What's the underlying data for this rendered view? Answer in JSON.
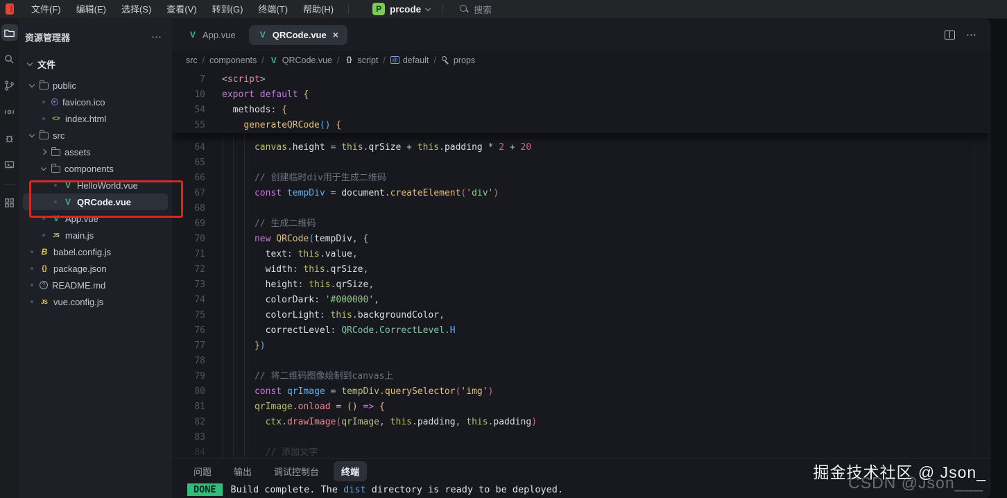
{
  "title_bar": {
    "menus": [
      {
        "id": "file",
        "label": "文件(F)"
      },
      {
        "id": "edit",
        "label": "编辑(E)"
      },
      {
        "id": "selection",
        "label": "选择(S)"
      },
      {
        "id": "view",
        "label": "查看(V)"
      },
      {
        "id": "go",
        "label": "转到(G)"
      },
      {
        "id": "terminal",
        "label": "终端(T)"
      },
      {
        "id": "help",
        "label": "帮助(H)"
      }
    ],
    "project": {
      "initial": "P",
      "name": "prcode"
    },
    "search_label": "搜索"
  },
  "activity_bar": {
    "items": [
      {
        "name": "explorer",
        "active": true
      },
      {
        "name": "search",
        "active": false
      },
      {
        "name": "source-control",
        "active": false
      },
      {
        "name": "references",
        "active": false
      },
      {
        "name": "debug",
        "active": false
      },
      {
        "name": "remote",
        "active": false
      },
      {
        "name": "extensions",
        "active": false,
        "after_divider": true
      }
    ]
  },
  "sidebar": {
    "title": "资源管理器",
    "more_label": "⋯",
    "section": "文件",
    "tree": [
      {
        "depth": 0,
        "slot": "down",
        "icon": "folder",
        "label": "public"
      },
      {
        "depth": 1,
        "slot": "dot",
        "icon": "palette",
        "label": "favicon.ico"
      },
      {
        "depth": 1,
        "slot": "dot",
        "icon": "html",
        "label": "index.html"
      },
      {
        "depth": 0,
        "slot": "down",
        "icon": "folder",
        "label": "src"
      },
      {
        "depth": 1,
        "slot": "right",
        "icon": "folder",
        "label": "assets"
      },
      {
        "depth": 1,
        "slot": "down",
        "icon": "folder",
        "label": "components"
      },
      {
        "depth": 2,
        "slot": "dot",
        "icon": "vue",
        "label": "HelloWorld.vue"
      },
      {
        "depth": 2,
        "slot": "dot",
        "icon": "vue",
        "label": "QRCode.vue",
        "selected": true
      },
      {
        "depth": 1,
        "slot": "dot",
        "icon": "vue",
        "label": "App.vue"
      },
      {
        "depth": 1,
        "slot": "dot",
        "icon": "js",
        "label": "main.js"
      },
      {
        "depth": 0,
        "slot": "dot",
        "icon": "babel",
        "label": "babel.config.js"
      },
      {
        "depth": 0,
        "slot": "dot",
        "icon": "json",
        "label": "package.json"
      },
      {
        "depth": 0,
        "slot": "dot",
        "icon": "readme",
        "label": "README.md"
      },
      {
        "depth": 0,
        "slot": "dot",
        "icon": "js",
        "label": "vue.config.js"
      }
    ]
  },
  "editor": {
    "tabs": [
      {
        "label": "App.vue",
        "icon": "vue",
        "active": false,
        "closable": false
      },
      {
        "label": "QRCode.vue",
        "icon": "vue",
        "active": true,
        "closable": true
      }
    ],
    "close_glyph": "×",
    "breadcrumbs": [
      {
        "label": "src"
      },
      {
        "label": "components"
      },
      {
        "icon": "vue",
        "label": "QRCode.vue"
      },
      {
        "icon": "braces",
        "label": "script"
      },
      {
        "icon": "symbol",
        "label": "default"
      },
      {
        "icon": "key",
        "label": "props"
      }
    ],
    "sticky_lines": [
      {
        "num": "7",
        "tokens": [
          [
            "d",
            "<"
          ],
          [
            "r",
            "script"
          ],
          [
            "d",
            ">"
          ]
        ]
      },
      {
        "num": "10",
        "tokens": [
          [
            "p",
            "export"
          ],
          [
            "w",
            " "
          ],
          [
            "p",
            "default"
          ],
          [
            "w",
            " "
          ],
          [
            "y",
            "{"
          ]
        ]
      },
      {
        "num": "54",
        "tokens": [
          [
            "w",
            "  methods"
          ],
          [
            "d",
            ":"
          ],
          [
            "w",
            " "
          ],
          [
            "y",
            "{"
          ]
        ]
      },
      {
        "num": "55",
        "tokens": [
          [
            "w",
            "    "
          ],
          [
            "y",
            "generateQRCode"
          ],
          [
            "b",
            "()"
          ],
          [
            "w",
            " "
          ],
          [
            "y",
            "{"
          ]
        ]
      }
    ],
    "lines": [
      {
        "num": "64",
        "tokens": [
          [
            "w",
            "      "
          ],
          [
            "o",
            "canvas"
          ],
          [
            "d",
            "."
          ],
          [
            "w",
            "height"
          ],
          [
            "d",
            " = "
          ],
          [
            "o",
            "this"
          ],
          [
            "d",
            "."
          ],
          [
            "w",
            "qrSize"
          ],
          [
            "d",
            " + "
          ],
          [
            "o",
            "this"
          ],
          [
            "d",
            "."
          ],
          [
            "w",
            "padding"
          ],
          [
            "d",
            " * "
          ],
          [
            "n",
            "2"
          ],
          [
            "d",
            " + "
          ],
          [
            "n",
            "20"
          ]
        ]
      },
      {
        "num": "65",
        "tokens": []
      },
      {
        "num": "66",
        "tokens": [
          [
            "w",
            "      "
          ],
          [
            "c",
            "// 创建临时div用于生成二维码"
          ]
        ]
      },
      {
        "num": "67",
        "tokens": [
          [
            "w",
            "      "
          ],
          [
            "p",
            "const"
          ],
          [
            "w",
            " "
          ],
          [
            "b",
            "tempDiv"
          ],
          [
            "d",
            " = "
          ],
          [
            "w",
            "document"
          ],
          [
            "d",
            "."
          ],
          [
            "y",
            "createElement"
          ],
          [
            "n",
            "("
          ],
          [
            "g",
            "'div'"
          ],
          [
            "n",
            ")"
          ]
        ]
      },
      {
        "num": "68",
        "tokens": []
      },
      {
        "num": "69",
        "tokens": [
          [
            "w",
            "      "
          ],
          [
            "c",
            "// 生成二维码"
          ]
        ]
      },
      {
        "num": "70",
        "tokens": [
          [
            "w",
            "      "
          ],
          [
            "p",
            "new"
          ],
          [
            "w",
            " "
          ],
          [
            "y",
            "QRCode"
          ],
          [
            "b",
            "("
          ],
          [
            "w",
            "tempDiv"
          ],
          [
            "d",
            ", "
          ],
          [
            "y",
            "{"
          ]
        ]
      },
      {
        "num": "71",
        "tokens": [
          [
            "w",
            "        text"
          ],
          [
            "d",
            ": "
          ],
          [
            "o",
            "this"
          ],
          [
            "d",
            "."
          ],
          [
            "w",
            "value"
          ],
          [
            "d",
            ","
          ]
        ]
      },
      {
        "num": "72",
        "tokens": [
          [
            "w",
            "        width"
          ],
          [
            "d",
            ": "
          ],
          [
            "o",
            "this"
          ],
          [
            "d",
            "."
          ],
          [
            "w",
            "qrSize"
          ],
          [
            "d",
            ","
          ]
        ]
      },
      {
        "num": "73",
        "tokens": [
          [
            "w",
            "        height"
          ],
          [
            "d",
            ": "
          ],
          [
            "o",
            "this"
          ],
          [
            "d",
            "."
          ],
          [
            "w",
            "qrSize"
          ],
          [
            "d",
            ","
          ]
        ]
      },
      {
        "num": "74",
        "tokens": [
          [
            "w",
            "        colorDark"
          ],
          [
            "d",
            ": "
          ],
          [
            "g",
            "'#000000'"
          ],
          [
            "d",
            ","
          ]
        ]
      },
      {
        "num": "75",
        "tokens": [
          [
            "w",
            "        colorLight"
          ],
          [
            "d",
            ": "
          ],
          [
            "o",
            "this"
          ],
          [
            "d",
            "."
          ],
          [
            "w",
            "backgroundColor"
          ],
          [
            "d",
            ","
          ]
        ]
      },
      {
        "num": "76",
        "tokens": [
          [
            "w",
            "        correctLevel"
          ],
          [
            "d",
            ": "
          ],
          [
            "t",
            "QRCode"
          ],
          [
            "d",
            "."
          ],
          [
            "t",
            "CorrectLevel"
          ],
          [
            "d",
            "."
          ],
          [
            "b",
            "H"
          ]
        ]
      },
      {
        "num": "77",
        "tokens": [
          [
            "w",
            "      "
          ],
          [
            "y",
            "}"
          ],
          [
            "b",
            ")"
          ]
        ]
      },
      {
        "num": "78",
        "tokens": []
      },
      {
        "num": "79",
        "tokens": [
          [
            "w",
            "      "
          ],
          [
            "c",
            "// 将二维码图像绘制到canvas上"
          ]
        ]
      },
      {
        "num": "80",
        "tokens": [
          [
            "w",
            "      "
          ],
          [
            "p",
            "const"
          ],
          [
            "w",
            " "
          ],
          [
            "b",
            "qrImage"
          ],
          [
            "d",
            " = "
          ],
          [
            "o",
            "tempDiv"
          ],
          [
            "d",
            "."
          ],
          [
            "y",
            "querySelector"
          ],
          [
            "n",
            "("
          ],
          [
            "y",
            "'img'"
          ],
          [
            "n",
            ")"
          ]
        ]
      },
      {
        "num": "81",
        "tokens": [
          [
            "w",
            "      "
          ],
          [
            "o",
            "qrImage"
          ],
          [
            "d",
            "."
          ],
          [
            "r",
            "onload"
          ],
          [
            "d",
            " = "
          ],
          [
            "y",
            "()"
          ],
          [
            "w",
            " "
          ],
          [
            "p",
            "=>"
          ],
          [
            "w",
            " "
          ],
          [
            "y",
            "{"
          ]
        ]
      },
      {
        "num": "82",
        "tokens": [
          [
            "w",
            "        "
          ],
          [
            "o",
            "ctx"
          ],
          [
            "d",
            "."
          ],
          [
            "r",
            "drawImage"
          ],
          [
            "n",
            "("
          ],
          [
            "o",
            "qrImage"
          ],
          [
            "d",
            ", "
          ],
          [
            "o",
            "this"
          ],
          [
            "d",
            "."
          ],
          [
            "w",
            "padding"
          ],
          [
            "d",
            ", "
          ],
          [
            "o",
            "this"
          ],
          [
            "d",
            "."
          ],
          [
            "w",
            "padding"
          ],
          [
            "n",
            ")"
          ]
        ]
      },
      {
        "num": "83",
        "tokens": []
      },
      {
        "num": "84",
        "fade": true,
        "tokens": [
          [
            "w",
            "        "
          ],
          [
            "c",
            "// 添加文字"
          ]
        ]
      }
    ]
  },
  "panel": {
    "tabs": [
      {
        "label": "问题",
        "active": false
      },
      {
        "label": "输出",
        "active": false
      },
      {
        "label": "调试控制台",
        "active": false
      },
      {
        "label": "终端",
        "active": true
      }
    ],
    "terminal": {
      "badge": "DONE",
      "message_before": "Build complete. The ",
      "highlight": "dist",
      "message_after": " directory is ready to be deployed."
    }
  },
  "watermarks": {
    "primary": "掘金技术社区 @ Json_",
    "secondary": "CSDN @Json___"
  },
  "colors": {
    "vue_green": "#42b883",
    "badge_green": "#2fbe7e",
    "annotation_red": "#d5281e",
    "project_badge_green": "#7ccb55"
  }
}
